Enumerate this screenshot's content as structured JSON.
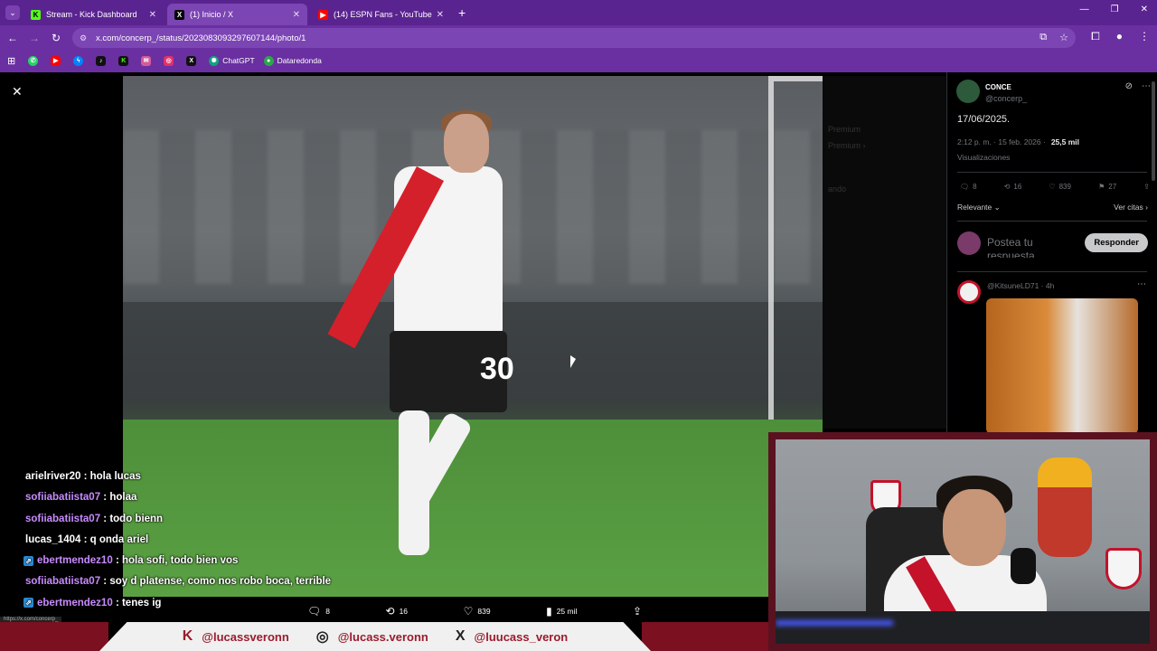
{
  "browser": {
    "tabs": [
      {
        "label": "Stream - Kick Dashboard",
        "icon": "kick-icon",
        "color": "#53fc18"
      },
      {
        "label": "(1) Inicio / X",
        "icon": "x-icon",
        "color": "#000000"
      },
      {
        "label": "(14) ESPN Fans - YouTube",
        "icon": "youtube-icon",
        "color": "#ff0000"
      }
    ],
    "url": "x.com/concerp_/status/2023083093297607144/photo/1",
    "bookmarks": [
      {
        "label": "",
        "icon": "whatsapp-icon",
        "color": "#25d366"
      },
      {
        "label": "",
        "icon": "youtube-icon",
        "color": "#ff0000"
      },
      {
        "label": "",
        "icon": "messenger-icon",
        "color": "#0084ff"
      },
      {
        "label": "",
        "icon": "tiktok-icon",
        "color": "#111111"
      },
      {
        "label": "",
        "icon": "kick-icon",
        "color": "#111111"
      },
      {
        "label": "",
        "icon": "mail-icon",
        "color": "#d45a9a"
      },
      {
        "label": "",
        "icon": "instagram-icon",
        "color": "#e1306c"
      },
      {
        "label": "",
        "icon": "x-icon",
        "color": "#111111"
      },
      {
        "label": "ChatGPT",
        "icon": "chatgpt-icon",
        "color": "#10a37f"
      },
      {
        "label": "Dataredonda",
        "icon": "dataredonda-icon",
        "color": "#2aa84a"
      }
    ]
  },
  "photo_viewer": {
    "actions": {
      "replies": "8",
      "reposts": "16",
      "likes": "839",
      "views": "25 mil"
    },
    "jersey_number": "30"
  },
  "tweet": {
    "display_name": "CONCE",
    "handle": "@concerp_",
    "text": "17/06/2025.",
    "timestamp": "2:12 p. m. · 15 feb. 2026 ·",
    "views_count": "25,5 mil",
    "views_label": "Visualizaciones",
    "replies": "8",
    "reposts": "16",
    "likes": "839",
    "bookmarks": "27",
    "sort_label": "Relevante",
    "quotes_label": "Ver citas",
    "reply_placeholder": "Postea tu respuesta",
    "reply_button": "Responder",
    "first_reply_handle": "@KitsuneLD71 · 4h"
  },
  "chat": [
    {
      "user": "arielriver20",
      "text": ": hola lucas",
      "color": "#ffffff",
      "badge": false
    },
    {
      "user": "sofiiabatiista07",
      "text": ": holaa",
      "color": "#c88bff",
      "badge": false
    },
    {
      "user": "sofiiabatiista07",
      "text": ": todo bienn",
      "color": "#c88bff",
      "badge": false
    },
    {
      "user": "lucas_1404",
      "text": ": q onda ariel",
      "color": "#ffffff",
      "badge": false
    },
    {
      "user": "ebertmendez10",
      "text": ": hola sofi, todo bien vos",
      "color": "#c88bff",
      "badge": true
    },
    {
      "user": "sofiiabatiista07",
      "text": ": soy d platense, como nos robo boca, terrible",
      "color": "#c88bff",
      "badge": false
    },
    {
      "user": "ebertmendez10",
      "text": ": tenes ig",
      "color": "#c88bff",
      "badge": true
    }
  ],
  "status_url": "https://x.com/concerp_",
  "socials": [
    {
      "icon": "kick-icon",
      "handle": "@lucassveronn"
    },
    {
      "icon": "instagram-icon",
      "handle": "@lucass.veronn"
    },
    {
      "icon": "x-icon",
      "handle": "@luucass_veron"
    }
  ]
}
